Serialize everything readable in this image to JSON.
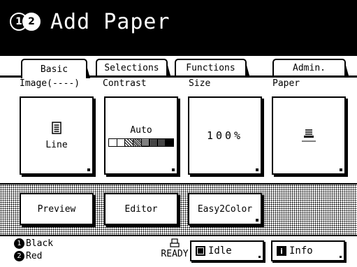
{
  "header": {
    "title": "Add Paper",
    "drum_badge": [
      "1",
      "2"
    ],
    "drum_badge_icon": "drum-1-2-icon"
  },
  "tabs": [
    {
      "label": "Basic",
      "active": true
    },
    {
      "label": "Selections",
      "active": false
    },
    {
      "label": "Functions",
      "active": false
    },
    {
      "label": "Admin.",
      "active": false
    }
  ],
  "settings": {
    "image_label": "Image(----)",
    "image_value": "Line",
    "contrast_label": "Contrast",
    "contrast_value": "Auto",
    "size_label": "Size",
    "size_value": "100%",
    "paper_label": "Paper",
    "paper_icon": "paper-tray-icon"
  },
  "actions": {
    "preview": "Preview",
    "editor": "Editor",
    "easy2color": "Easy2Color"
  },
  "status": {
    "drum1_num": "1",
    "drum1_color": "Black",
    "drum2_num": "2",
    "drum2_color": "Red",
    "ready": "READY",
    "idle": "Idle",
    "info": "Info",
    "info_icon_letter": "i"
  },
  "colors": {
    "foreground": "#000000",
    "background": "#ffffff"
  }
}
